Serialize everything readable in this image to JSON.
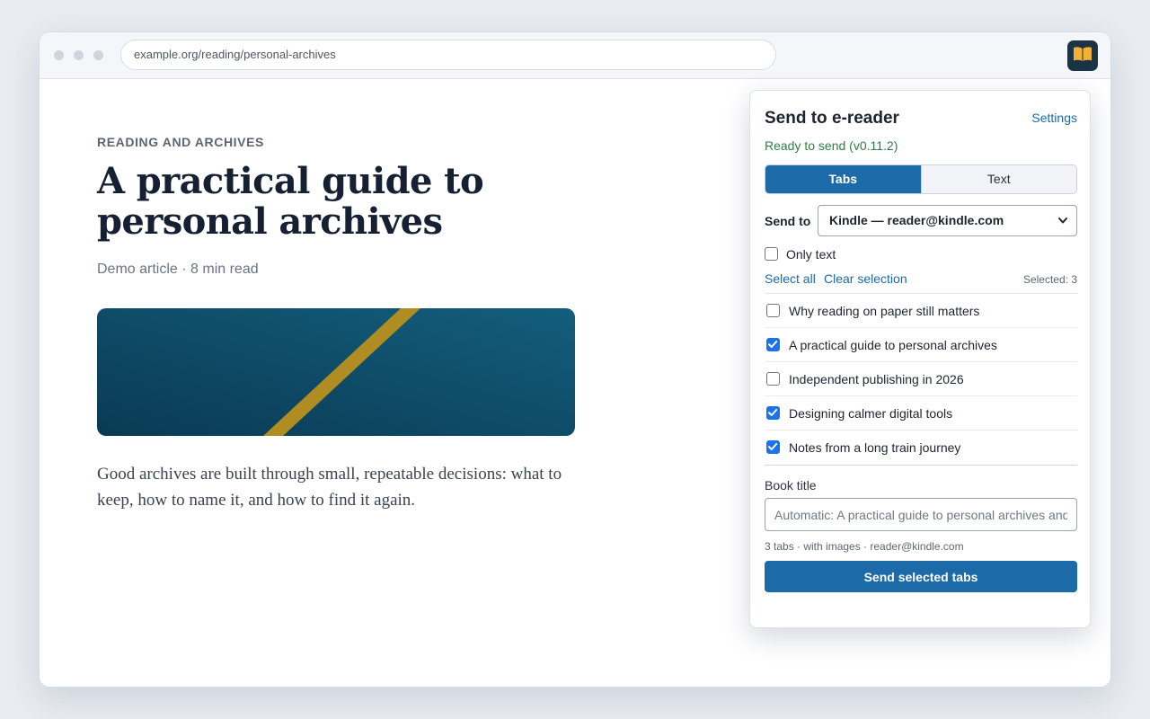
{
  "browser": {
    "url": "example.org/reading/personal-archives",
    "extension_icon": "book-icon"
  },
  "article": {
    "kicker": "READING AND ARCHIVES",
    "title": "A practical guide to personal archives",
    "meta": "Demo article · 8 min read",
    "body": "Good archives are built through small, repeatable decisions: what to keep, how to name it, and how to find it again.",
    "hero_colors": {
      "dark": "#0a3a54",
      "light": "#135e7c",
      "stripe": "#b08d22"
    }
  },
  "popup": {
    "title": "Send to e-reader",
    "settings_label": "Settings",
    "status": "Ready to send (v0.11.2)",
    "modes": [
      {
        "label": "Tabs",
        "active": true
      },
      {
        "label": "Text",
        "active": false
      }
    ],
    "send_to_label": "Send to",
    "send_to_value": "Kindle — reader@kindle.com",
    "only_text_label": "Only text",
    "only_text_checked": false,
    "select_all_label": "Select all",
    "clear_selection_label": "Clear selection",
    "selected_count": "Selected: 3",
    "tabs": [
      {
        "label": "Why reading on paper still matters",
        "checked": false
      },
      {
        "label": "A practical guide to personal archives",
        "checked": true
      },
      {
        "label": "Independent publishing in 2026",
        "checked": false
      },
      {
        "label": "Designing calmer digital tools",
        "checked": true
      },
      {
        "label": "Notes from a long train journey",
        "checked": true
      }
    ],
    "book_title_label": "Book title",
    "book_title_placeholder": "Automatic: A practical guide to personal archives and",
    "summary": "3 tabs · with images · reader@kindle.com",
    "send_button_label": "Send selected tabs",
    "accent": "#1c6aa8"
  }
}
